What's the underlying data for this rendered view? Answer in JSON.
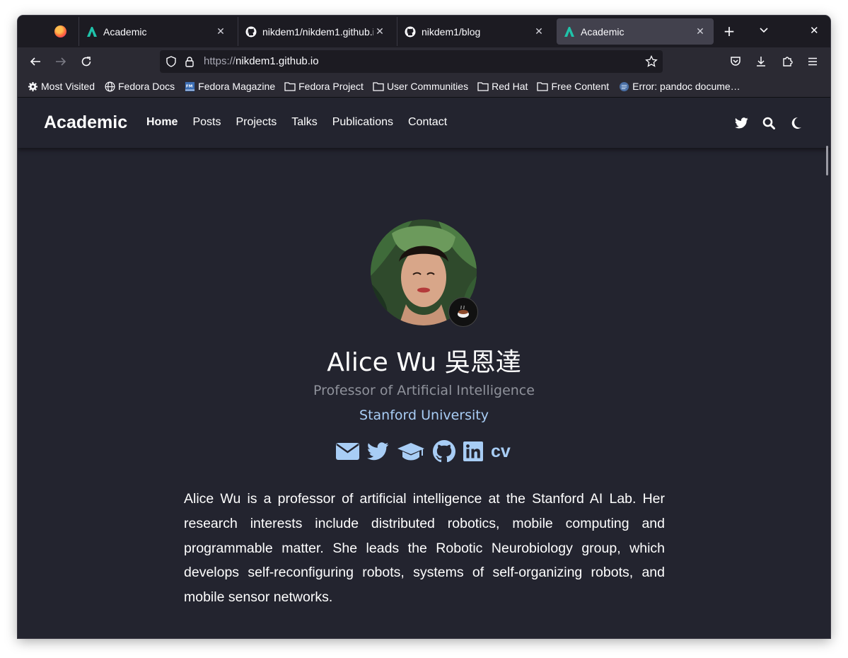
{
  "browser": {
    "tabs": [
      {
        "title": "Academic",
        "active": false
      },
      {
        "title": "nikdem1/nikdem1.github.io",
        "active": false
      },
      {
        "title": "nikdem1/blog",
        "active": false
      },
      {
        "title": "Academic",
        "active": true
      }
    ],
    "url_protocol": "https://",
    "url_host": "nikdem1.github.io",
    "bookmarks": [
      {
        "label": "Most Visited",
        "icon": "gear-icon"
      },
      {
        "label": "Fedora Docs",
        "icon": "globe-icon"
      },
      {
        "label": "Fedora Magazine",
        "icon": "fedora-magazine-icon"
      },
      {
        "label": "Fedora Project",
        "icon": "folder-icon"
      },
      {
        "label": "User Communities",
        "icon": "folder-icon"
      },
      {
        "label": "Red Hat",
        "icon": "folder-icon"
      },
      {
        "label": "Free Content",
        "icon": "folder-icon"
      },
      {
        "label": "Error: pandoc docume…",
        "icon": "page-icon"
      }
    ]
  },
  "site": {
    "brand": "Academic",
    "menu": [
      "Home",
      "Posts",
      "Projects",
      "Talks",
      "Publications",
      "Contact"
    ],
    "active_menu": "Home",
    "nav_icons": [
      "twitter-icon",
      "search-icon",
      "moon-icon"
    ]
  },
  "profile": {
    "name": "Alice Wu 吳恩達",
    "role": "Professor of Artificial Intelligence",
    "organization": "Stanford University",
    "social_icons": [
      "envelope-icon",
      "twitter-icon",
      "graduation-cap-icon",
      "github-icon",
      "linkedin-icon"
    ],
    "cv_label": "cv",
    "bio": "Alice Wu is a professor of artificial intelligence at the Stanford AI Lab. Her research interests include distributed robotics, mobile computing and programmable matter. She leads the Robotic Neurobiology group, which develops self-reconfiguring robots, systems of self-organizing robots, and mobile sensor networks."
  },
  "colors": {
    "page_bg": "#23242f",
    "link": "#a8cdf5",
    "muted": "#8f929b",
    "brand_green": "#1fc3aa"
  }
}
